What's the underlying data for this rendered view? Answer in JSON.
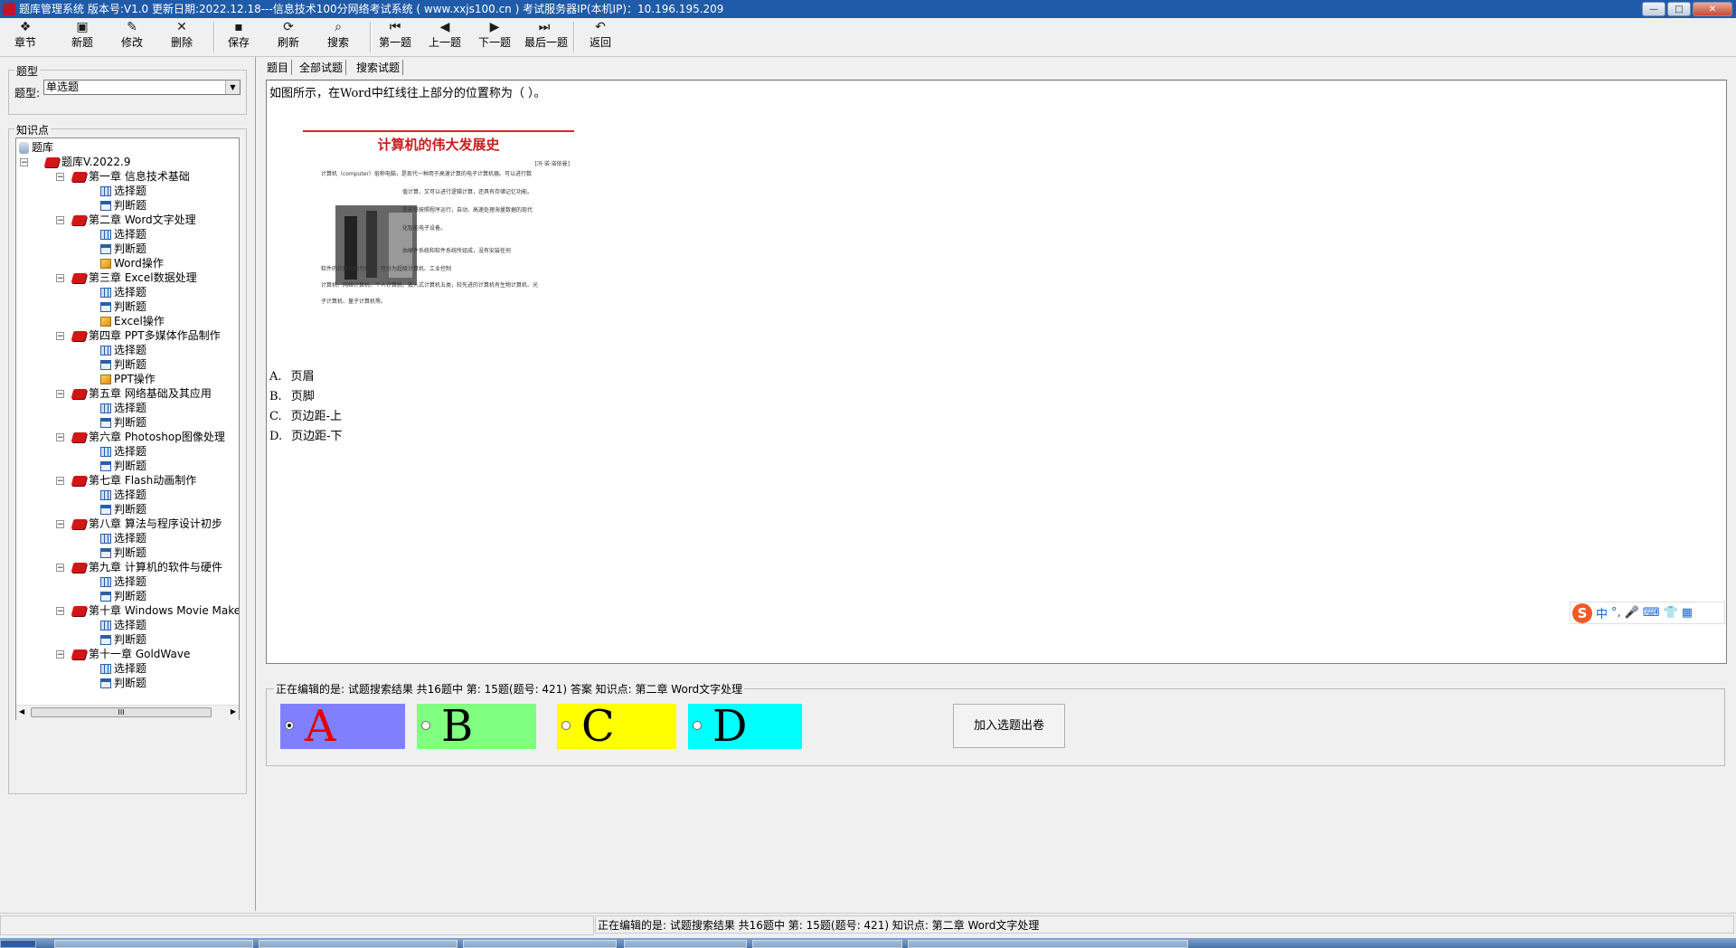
{
  "window": {
    "title": "题库管理系统 版本号:V1.0 更新日期:2022.12.18---信息技术100分网络考试系统   ( www.xxjs100.cn )    考试服务器IP(本机IP)：10.196.195.209",
    "buttons": {
      "minimize": "—",
      "maximize": "□",
      "close": "✕"
    }
  },
  "toolbar": {
    "items": [
      {
        "label": "章节",
        "icon": "chapter-icon",
        "glyph": "❖"
      },
      {
        "label": "新题",
        "icon": "new-icon",
        "glyph": "▣"
      },
      {
        "label": "修改",
        "icon": "edit-icon",
        "glyph": "✎"
      },
      {
        "label": "删除",
        "icon": "delete-icon",
        "glyph": "✕"
      },
      {
        "label": "保存",
        "icon": "save-icon",
        "glyph": "▪"
      },
      {
        "label": "刷新",
        "icon": "refresh-icon",
        "glyph": "⟳"
      },
      {
        "label": "搜索",
        "icon": "search-icon",
        "glyph": "⌕"
      },
      {
        "label": "第一题",
        "icon": "first-icon",
        "glyph": "⏮"
      },
      {
        "label": "上一题",
        "icon": "prev-icon",
        "glyph": "◀"
      },
      {
        "label": "下一题",
        "icon": "next-icon",
        "glyph": "▶"
      },
      {
        "label": "最后一题",
        "icon": "last-icon",
        "glyph": "⏭"
      },
      {
        "label": "返回",
        "icon": "back-icon",
        "glyph": "↶"
      }
    ]
  },
  "left": {
    "type_group_label": "题型",
    "type_field_label": "题型:",
    "type_value": "单选题",
    "knowledge_label": "知识点",
    "tree": {
      "root": "题库",
      "bank": "题库V.2022.9",
      "chapters": [
        {
          "label": "第一章 信息技术基础",
          "children": [
            "选择题",
            "判断题"
          ]
        },
        {
          "label": "第二章 Word文字处理",
          "children": [
            "选择题",
            "判断题",
            "Word操作"
          ]
        },
        {
          "label": "第三章 Excel数据处理",
          "children": [
            "选择题",
            "判断题",
            "Excel操作"
          ]
        },
        {
          "label": "第四章 PPT多媒体作品制作",
          "children": [
            "选择题",
            "判断题",
            "PPT操作"
          ]
        },
        {
          "label": "第五章 网络基础及其应用",
          "children": [
            "选择题",
            "判断题"
          ]
        },
        {
          "label": "第六章 Photoshop图像处理",
          "children": [
            "选择题",
            "判断题"
          ]
        },
        {
          "label": "第七章 Flash动画制作",
          "children": [
            "选择题",
            "判断题"
          ]
        },
        {
          "label": "第八章 算法与程序设计初步",
          "children": [
            "选择题",
            "判断题"
          ]
        },
        {
          "label": "第九章 计算机的软件与硬件",
          "children": [
            "选择题",
            "判断题"
          ]
        },
        {
          "label": "第十章 Windows Movie Make",
          "children": [
            "选择题",
            "判断题"
          ]
        },
        {
          "label": "第十一章 GoldWave",
          "children": [
            "选择题",
            "判断题"
          ]
        }
      ]
    },
    "scroll_thumb": "III"
  },
  "tabs": [
    "题目",
    "全部试题",
    "搜索试题"
  ],
  "question": {
    "text": "如图所示，在Word中红线往上部分的位置称为（     ）。",
    "image": {
      "heading": "计算机的伟大发展史",
      "author": "[冯·诺·诺依曼]",
      "paragraphs": [
        "计算机（computer）俗称电脑，是现代一种用于高速计算的电子计算机器。可以进行数",
        "值计算，又可以进行逻辑计算，还具有存储记忆功能。",
        "是能够按照程序运行，自动、高速处理海量数据的现代",
        "化智能电子设备。",
        "由硬件系统和软件系统所组成，没有安装任何",
        "软件的计算机称为裸机。可分为超级计算机、工业控制",
        "计算机、网络计算机、个人计算机、嵌入式计算机五类，较先进的计算机有生物计算机、光",
        "子计算机、量子计算机等。"
      ]
    },
    "options": [
      {
        "key": "A.",
        "text": "页眉"
      },
      {
        "key": "B.",
        "text": "页脚"
      },
      {
        "key": "C.",
        "text": "页边距-上"
      },
      {
        "key": "D.",
        "text": "页边距-下"
      }
    ]
  },
  "ime": {
    "logo": "S",
    "items": [
      "中",
      "°,",
      "🎤",
      "⌨",
      "👕",
      "▦"
    ]
  },
  "answer": {
    "legend": "正在编辑的是: 试题搜索结果 共16题中  第: 15题(题号: 421) 答案 知识点: 第二章 Word文字处理",
    "choices": [
      {
        "letter": "A",
        "color": "#8080ff",
        "selected": true
      },
      {
        "letter": "B",
        "color": "#80ff80",
        "selected": false
      },
      {
        "letter": "C",
        "color": "#ffff00",
        "selected": false
      },
      {
        "letter": "D",
        "color": "#00ffff",
        "selected": false
      }
    ],
    "add_button": "加入选题出卷"
  },
  "status": {
    "text": "正在编辑的是: 试题搜索结果 共16题中  第: 15题(题号: 421)  知识点: 第二章 Word文字处理"
  }
}
